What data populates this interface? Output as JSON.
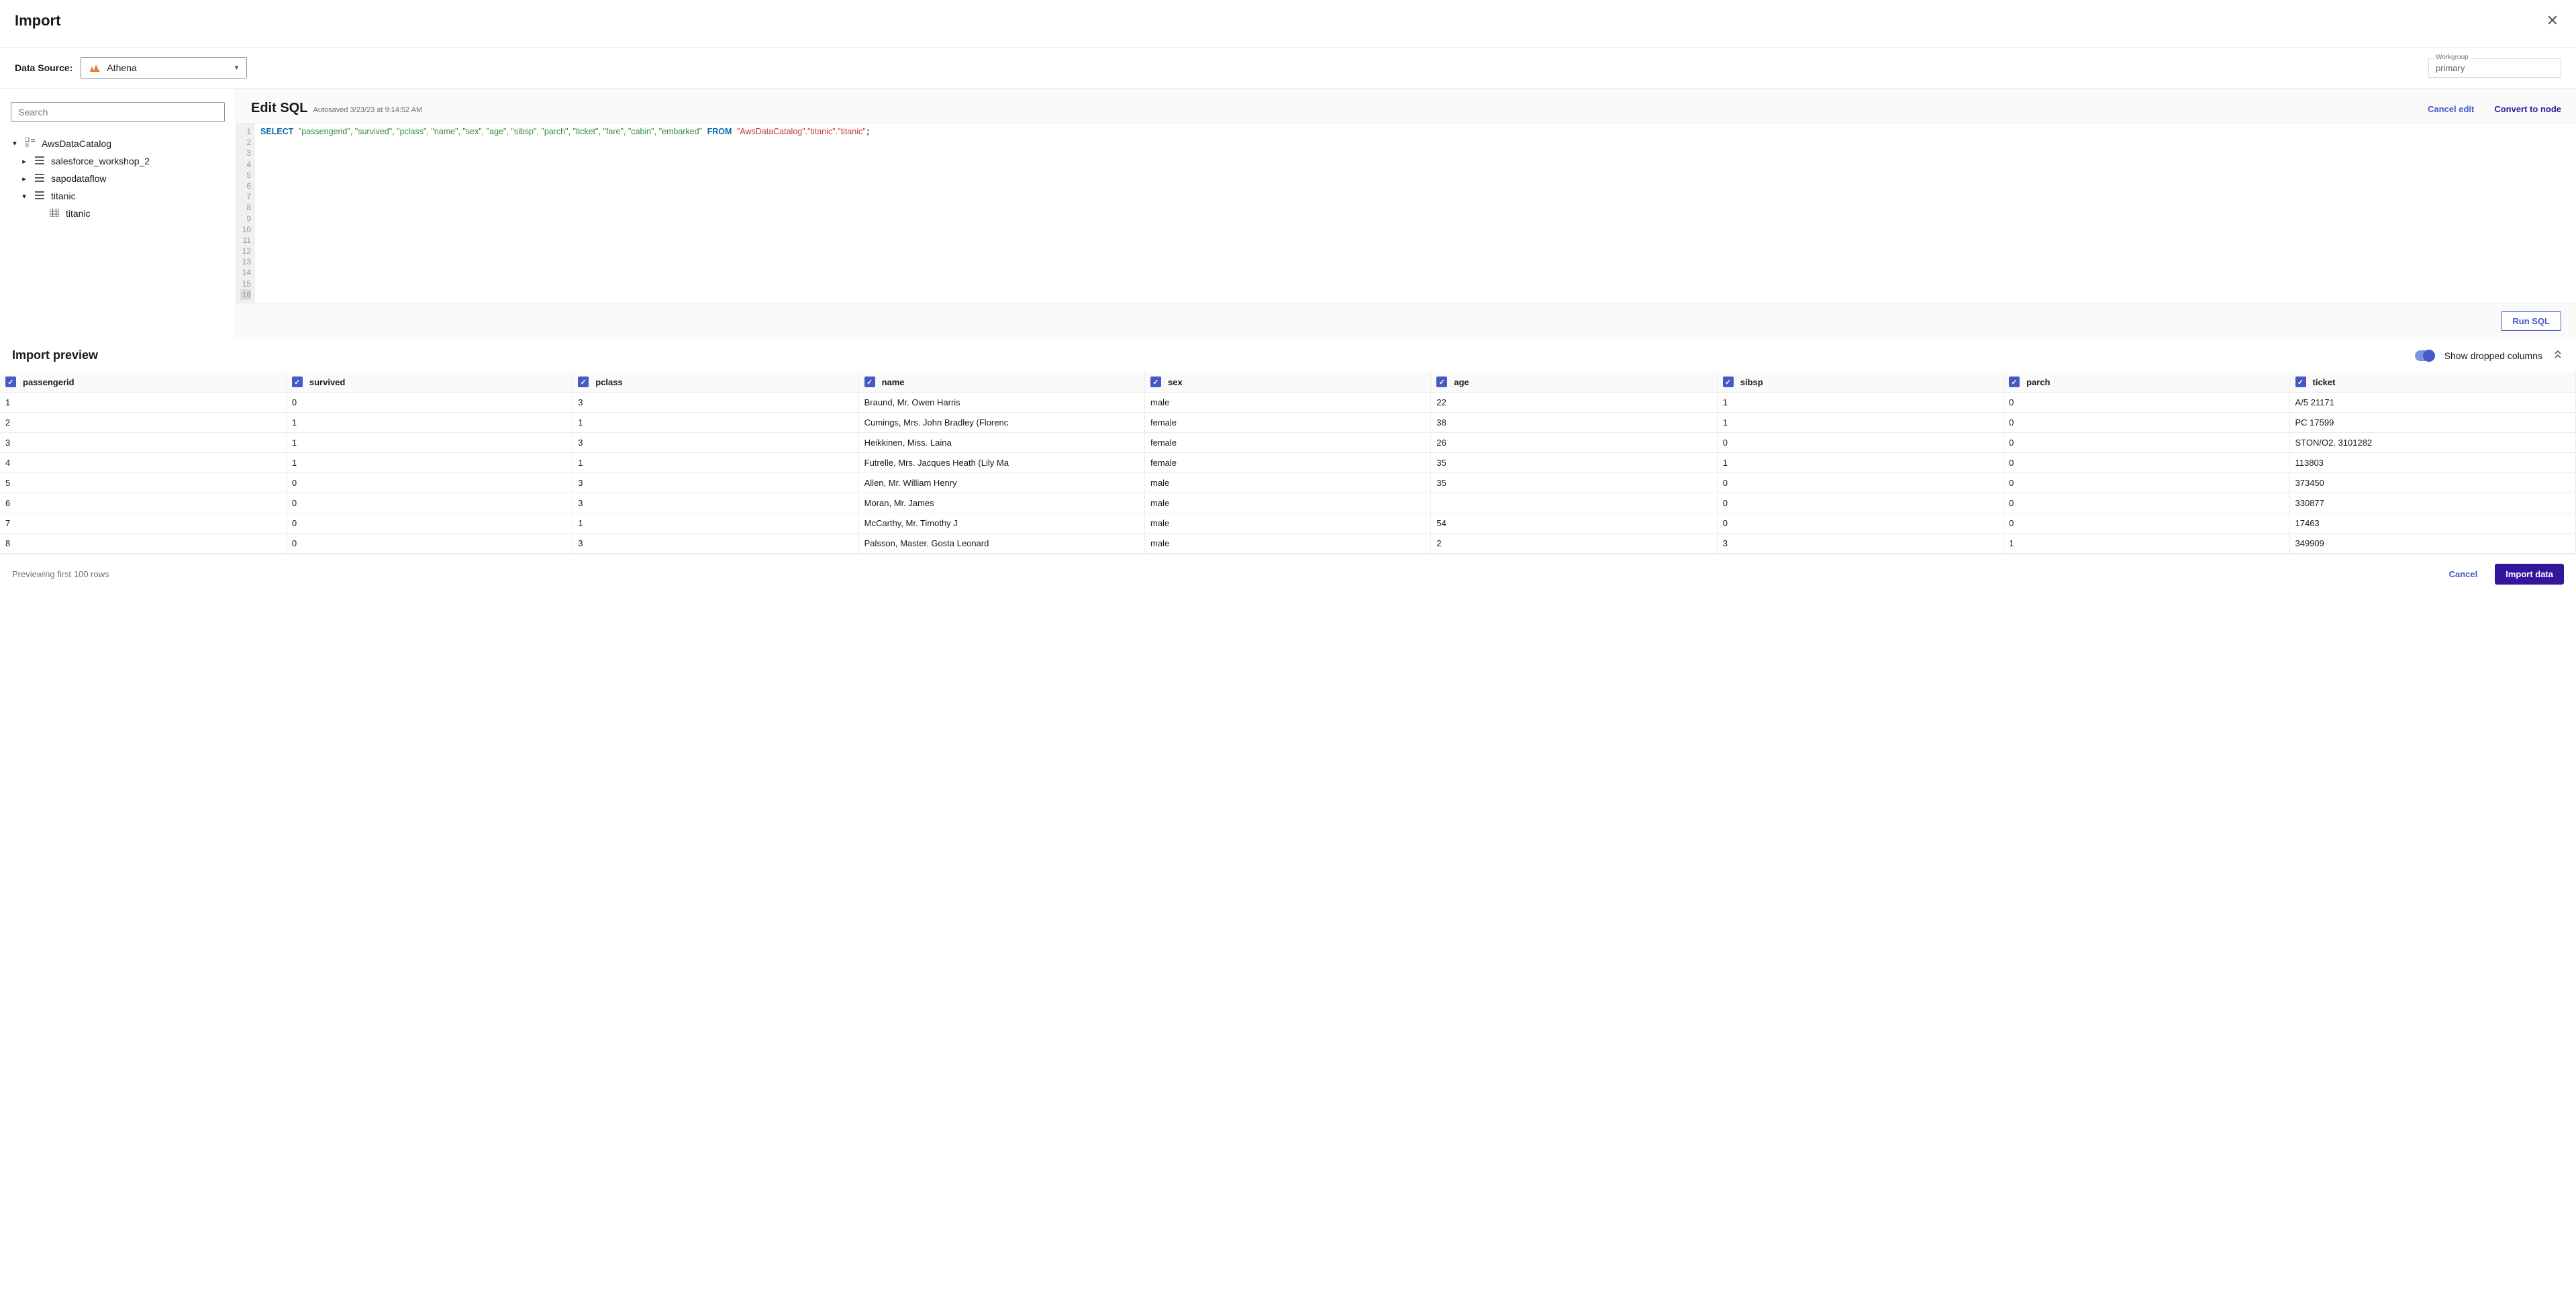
{
  "header": {
    "title": "Import"
  },
  "dataSource": {
    "label": "Data Source:",
    "value": "Athena",
    "workgroupLabel": "Workgroup",
    "workgroupValue": "primary"
  },
  "sidebar": {
    "searchPlaceholder": "Search",
    "catalog": "AwsDataCatalog",
    "schemas": [
      {
        "name": "salesforce_workshop_2",
        "expanded": false
      },
      {
        "name": "sapodataflow",
        "expanded": false
      },
      {
        "name": "titanic",
        "expanded": true,
        "tables": [
          "titanic"
        ]
      }
    ]
  },
  "sql": {
    "title": "Edit SQL",
    "autosaved": "Autosaved 3/23/23 at 9:14:52 AM",
    "cancelEdit": "Cancel edit",
    "convert": "Convert to node",
    "runBtn": "Run SQL",
    "code": {
      "select": "SELECT",
      "cols": "\"passengerid\", \"survived\", \"pclass\", \"name\", \"sex\", \"age\", \"sibsp\", \"parch\", \"ticket\", \"fare\", \"cabin\", \"embarked\"",
      "from": "FROM",
      "table": "\"AwsDataCatalog\".\"titanic\".\"titanic\""
    }
  },
  "preview": {
    "title": "Import preview",
    "showDropped": "Show dropped columns",
    "columns": [
      "passengerid",
      "survived",
      "pclass",
      "name",
      "sex",
      "age",
      "sibsp",
      "parch",
      "ticket"
    ],
    "rows": [
      [
        "1",
        "0",
        "3",
        "Braund, Mr. Owen Harris",
        "male",
        "22",
        "1",
        "0",
        "A/5 21171"
      ],
      [
        "2",
        "1",
        "1",
        "Cumings, Mrs. John Bradley (Florenc",
        "female",
        "38",
        "1",
        "0",
        "PC 17599"
      ],
      [
        "3",
        "1",
        "3",
        "Heikkinen, Miss. Laina",
        "female",
        "26",
        "0",
        "0",
        "STON/O2. 3101282"
      ],
      [
        "4",
        "1",
        "1",
        "Futrelle, Mrs. Jacques Heath (Lily Ma",
        "female",
        "35",
        "1",
        "0",
        "113803"
      ],
      [
        "5",
        "0",
        "3",
        "Allen, Mr. William Henry",
        "male",
        "35",
        "0",
        "0",
        "373450"
      ],
      [
        "6",
        "0",
        "3",
        "Moran, Mr. James",
        "male",
        "",
        "0",
        "0",
        "330877"
      ],
      [
        "7",
        "0",
        "1",
        "McCarthy, Mr. Timothy J",
        "male",
        "54",
        "0",
        "0",
        "17463"
      ],
      [
        "8",
        "0",
        "3",
        "Palsson, Master. Gosta Leonard",
        "male",
        "2",
        "3",
        "1",
        "349909"
      ]
    ]
  },
  "footer": {
    "status": "Previewing first 100 rows",
    "cancel": "Cancel",
    "import": "Import data"
  }
}
